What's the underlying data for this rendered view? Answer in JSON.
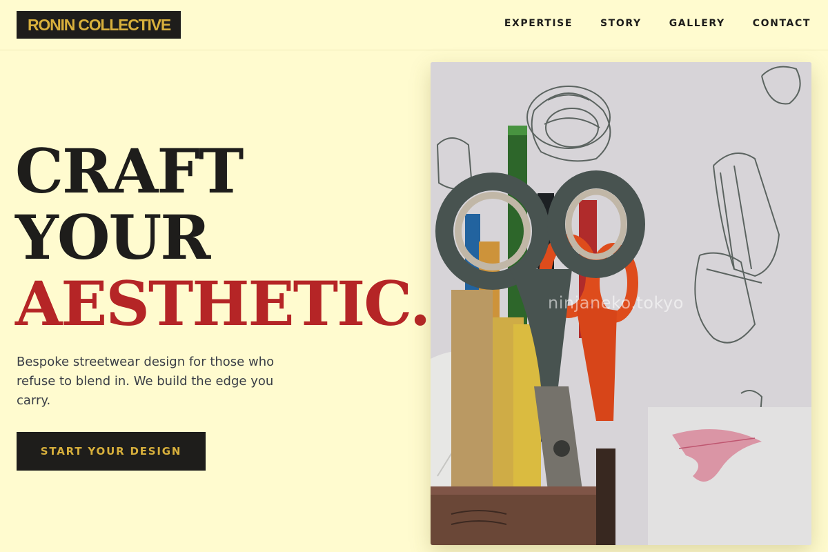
{
  "brand": {
    "name": "RONIN COLLECTIVE"
  },
  "nav": {
    "items": [
      "EXPERTISE",
      "STORY",
      "GALLERY",
      "CONTACT"
    ]
  },
  "hero": {
    "headline_line1": "CRAFT",
    "headline_line2": "YOUR",
    "headline_line3": "AESTHETIC.",
    "subtext": "Bespoke streetwear design for those who refuse to blend in. We build the edge you carry.",
    "cta_label": "START YOUR DESIGN"
  },
  "image": {
    "watermark": "ninjaneko.tokyo",
    "subject": "pencil-cup-with-scissors-and-sketches"
  },
  "colors": {
    "background": "#fffbcf",
    "ink": "#1e1d1b",
    "accent_red": "#b52526",
    "accent_gold": "#d8b03c"
  }
}
